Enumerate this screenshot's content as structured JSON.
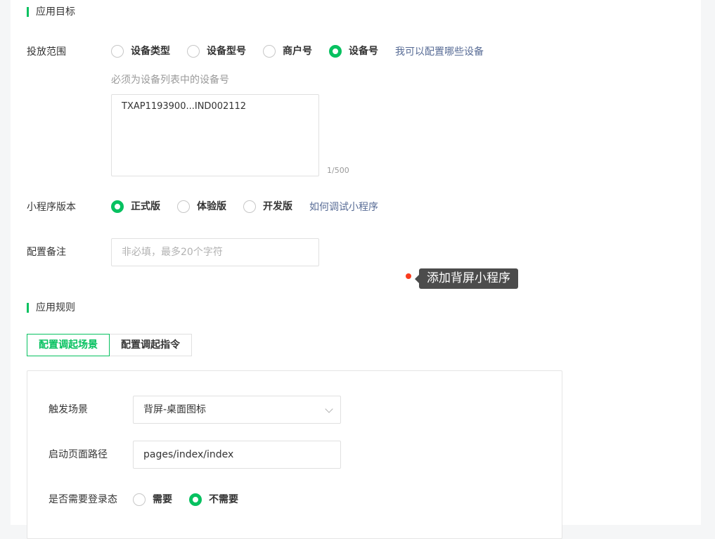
{
  "target_section": {
    "title": "应用目标",
    "scope": {
      "label": "投放范围",
      "options": [
        "设备类型",
        "设备型号",
        "商户号",
        "设备号"
      ],
      "selected": "设备号",
      "help_link": "我可以配置哪些设备"
    },
    "device_hint": "必须为设备列表中的设备号",
    "device_value": "TXAP1193900...IND002112",
    "char_counter": "1/500",
    "version": {
      "label": "小程序版本",
      "options": [
        "正式版",
        "体验版",
        "开发版"
      ],
      "selected": "正式版",
      "help_link": "如何调试小程序"
    },
    "remark": {
      "label": "配置备注",
      "placeholder": "非必填，最多20个字符"
    }
  },
  "tooltip": {
    "text": "添加背屏小程序"
  },
  "rules_section": {
    "title": "应用规则",
    "tabs": [
      "配置调起场景",
      "配置调起指令"
    ],
    "active_tab": "配置调起场景",
    "trigger": {
      "label": "触发场景",
      "value": "背屏-桌面图标"
    },
    "path": {
      "label": "启动页面路径",
      "value": "pages/index/index"
    },
    "login": {
      "label": "是否需要登录态",
      "options": [
        "需要",
        "不需要"
      ],
      "selected": "不需要"
    }
  },
  "colors": {
    "accent": "#07c160",
    "link": "#576b95",
    "tooltip_bg": "#4c4c4c",
    "marker": "#fa3c1e"
  }
}
